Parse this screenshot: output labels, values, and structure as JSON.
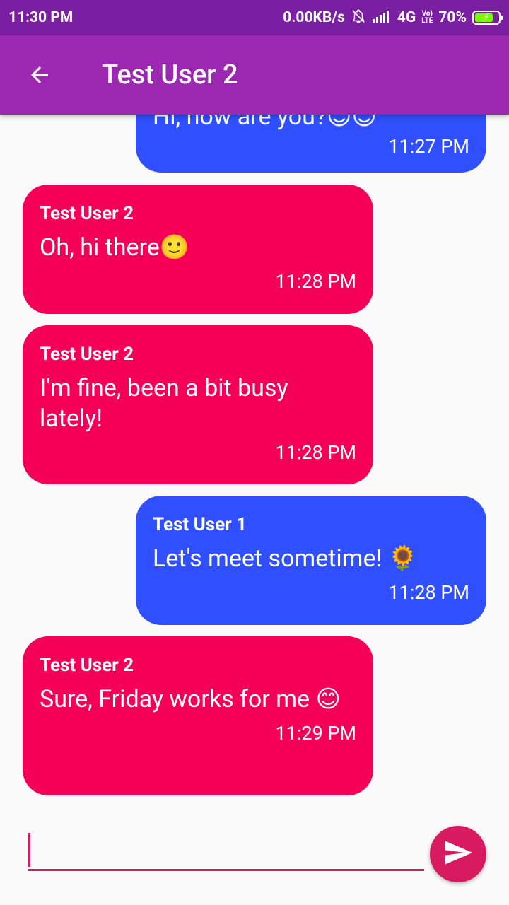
{
  "status_bar": {
    "time": "11:30 PM",
    "network_speed": "0.00KB/s",
    "network_type": "4G",
    "volte": "VoLTE",
    "battery": "70%"
  },
  "app_bar": {
    "title": "Test User 2"
  },
  "messages": [
    {
      "sender": "",
      "text": "Hi, how are you?😊😊",
      "time": "11:27 PM",
      "side": "right"
    },
    {
      "sender": "Test User 2",
      "text": "Oh, hi there🙂",
      "time": "11:28 PM",
      "side": "left"
    },
    {
      "sender": "Test User 2",
      "text": "I'm fine, been a bit busy lately!",
      "time": "11:28 PM",
      "side": "left"
    },
    {
      "sender": "Test User 1",
      "text": "Let's meet sometime! 🌻",
      "time": "11:28 PM",
      "side": "right"
    },
    {
      "sender": "Test User 2",
      "text": "Sure, Friday works for me 😊",
      "time": "11:29 PM",
      "side": "left"
    }
  ],
  "composer": {
    "placeholder": "",
    "value": ""
  },
  "colors": {
    "status_bar": "#7b1fa2",
    "app_bar": "#9c27b0",
    "incoming": "#f50057",
    "outgoing": "#304ffe",
    "accent": "#d81b60"
  },
  "icons": {
    "back": "arrow-back-icon",
    "send": "send-icon"
  }
}
